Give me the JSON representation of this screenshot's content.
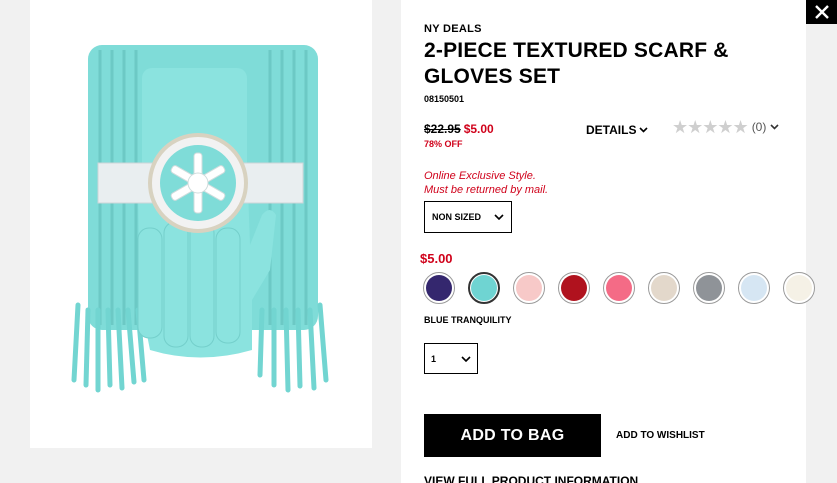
{
  "header": {
    "close_label": "Close"
  },
  "product": {
    "breadcrumb": "NY DEALS",
    "title": "2-PIECE TEXTURED SCARF & GLOVES SET",
    "sku": "08150501",
    "old_price": "$22.95",
    "sale_price": "$5.00",
    "discount": "78% OFF",
    "details_label": "DETAILS",
    "rating_count": "(0)",
    "rating_value": 0,
    "notice_line1": "Online Exclusive Style.",
    "notice_line2": "Must be returned by mail.",
    "size_value": "NON SIZED",
    "swatch_price": "$5.00",
    "selected_color": "BLUE TRANQUILITY",
    "quantity_value": "1",
    "add_to_bag": "ADD TO BAG",
    "wishlist": "ADD TO WISHLIST",
    "full_info": "VIEW FULL PRODUCT INFORMATION"
  },
  "colors": {
    "accent_red": "#d0021b",
    "image_product": "#7fdcd8"
  },
  "swatches": [
    {
      "name": "navy",
      "color": "#34276e",
      "selected": false
    },
    {
      "name": "blue-tranquility",
      "color": "#6fd4d2",
      "selected": true
    },
    {
      "name": "light-pink",
      "color": "#f7c9c8",
      "selected": false
    },
    {
      "name": "red",
      "color": "#b0121e",
      "selected": false
    },
    {
      "name": "pink",
      "color": "#f46b86",
      "selected": false
    },
    {
      "name": "beige",
      "color": "#e3d8cb",
      "selected": false
    },
    {
      "name": "grey",
      "color": "#8f9398",
      "selected": false
    },
    {
      "name": "light-blue",
      "color": "#d6e6f3",
      "selected": false
    },
    {
      "name": "ivory",
      "color": "#f5f1e6",
      "selected": false
    }
  ]
}
